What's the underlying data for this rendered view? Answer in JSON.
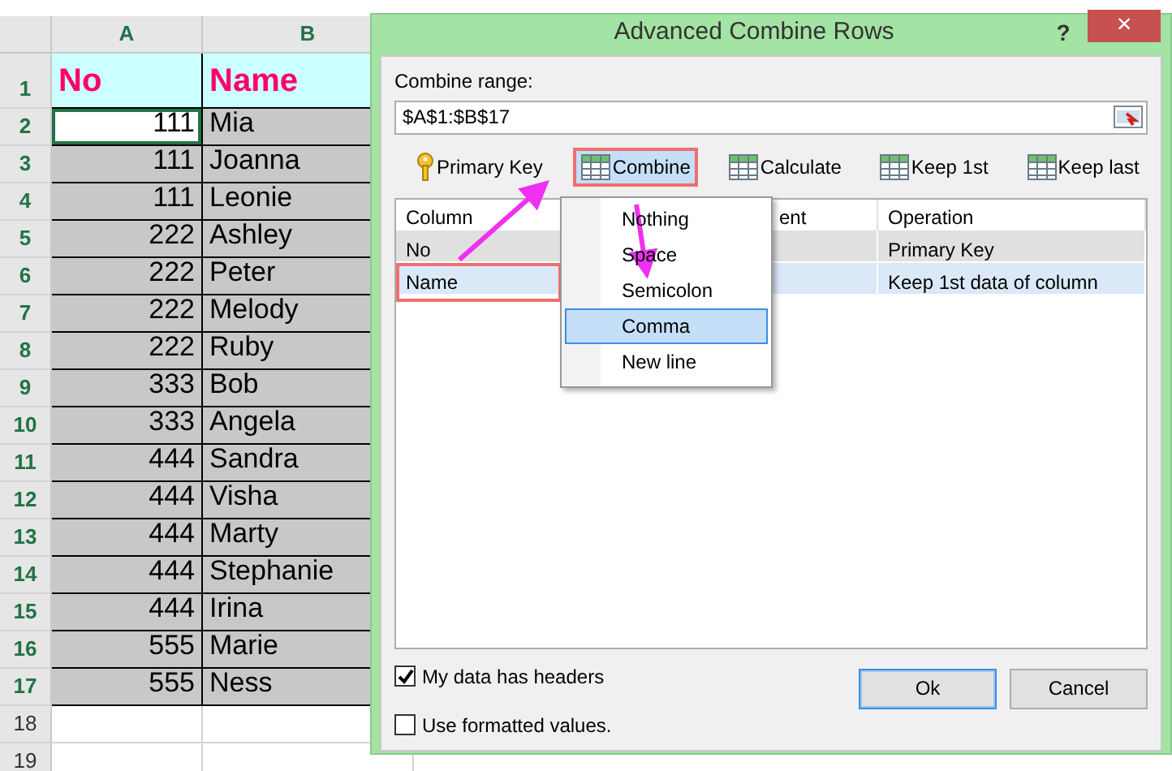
{
  "spreadsheet": {
    "columns": [
      "A",
      "B"
    ],
    "rows": [
      {
        "number": "1",
        "kind": "header",
        "cells": [
          "No",
          "Name"
        ]
      },
      {
        "number": "2",
        "kind": "data",
        "cells": [
          "111",
          "Mia"
        ],
        "selected": true
      },
      {
        "number": "3",
        "kind": "data",
        "cells": [
          "111",
          "Joanna"
        ],
        "selected": false
      },
      {
        "number": "4",
        "kind": "data",
        "cells": [
          "111",
          "Leonie"
        ],
        "selected": false
      },
      {
        "number": "5",
        "kind": "data",
        "cells": [
          "222",
          "Ashley"
        ],
        "selected": false
      },
      {
        "number": "6",
        "kind": "data",
        "cells": [
          "222",
          "Peter"
        ],
        "selected": false
      },
      {
        "number": "7",
        "kind": "data",
        "cells": [
          "222",
          "Melody"
        ],
        "selected": false
      },
      {
        "number": "8",
        "kind": "data",
        "cells": [
          "222",
          "Ruby"
        ],
        "selected": false
      },
      {
        "number": "9",
        "kind": "data",
        "cells": [
          "333",
          "Bob"
        ],
        "selected": false
      },
      {
        "number": "10",
        "kind": "data",
        "cells": [
          "333",
          "Angela"
        ],
        "selected": false
      },
      {
        "number": "11",
        "kind": "data",
        "cells": [
          "444",
          "Sandra"
        ],
        "selected": false
      },
      {
        "number": "12",
        "kind": "data",
        "cells": [
          "444",
          "Visha"
        ],
        "selected": false
      },
      {
        "number": "13",
        "kind": "data",
        "cells": [
          "444",
          "Marty"
        ],
        "selected": false
      },
      {
        "number": "14",
        "kind": "data",
        "cells": [
          "444",
          "Stephanie"
        ],
        "selected": false
      },
      {
        "number": "15",
        "kind": "data",
        "cells": [
          "444",
          "Irina"
        ],
        "selected": false
      },
      {
        "number": "16",
        "kind": "data",
        "cells": [
          "555",
          "Marie"
        ],
        "selected": false
      },
      {
        "number": "17",
        "kind": "data",
        "cells": [
          "555",
          "Ness"
        ],
        "selected": false
      },
      {
        "number": "18",
        "kind": "empty"
      },
      {
        "number": "19",
        "kind": "empty"
      }
    ]
  },
  "dialog": {
    "title": "Advanced Combine Rows",
    "help": "?",
    "close": "×",
    "range_label": "Combine range:",
    "range_value": "$A$1:$B$17",
    "toolbar": [
      {
        "label": "Primary Key",
        "kind": "key",
        "highlighted": false
      },
      {
        "label": "Combine",
        "kind": "grid",
        "highlighted": true
      },
      {
        "label": "Calculate",
        "kind": "grid",
        "highlighted": false
      },
      {
        "label": "Keep 1st",
        "kind": "grid",
        "highlighted": false
      },
      {
        "label": "Keep last",
        "kind": "grid",
        "highlighted": false
      }
    ],
    "table": {
      "columns": [
        "Column",
        "ent",
        "Operation"
      ],
      "rows": [
        {
          "column": "No",
          "operation": "Primary Key",
          "selected": false,
          "highlighted": false
        },
        {
          "column": "Name",
          "operation": "Keep 1st data of column",
          "selected": true,
          "highlighted": true
        }
      ]
    },
    "menu": [
      {
        "label": "Nothing",
        "selected": false
      },
      {
        "label": "Space",
        "selected": false
      },
      {
        "label": "Semicolon",
        "selected": false
      },
      {
        "label": "Comma",
        "selected": true
      },
      {
        "label": "New line",
        "selected": false
      }
    ],
    "checkboxes": [
      {
        "label": "My data has headers",
        "checked": true
      },
      {
        "label": "Use formatted values.",
        "checked": false
      }
    ],
    "buttons": [
      {
        "label": "Ok",
        "default": true
      },
      {
        "label": "Cancel",
        "default": false
      }
    ]
  }
}
